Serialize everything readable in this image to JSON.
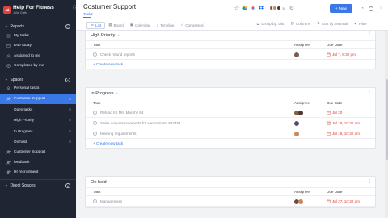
{
  "app": {
    "title": "Help For Fitness",
    "user": "Julia Gatto"
  },
  "sidebar": {
    "reports_label": "Reports",
    "reports_items": [
      {
        "label": "My tasks"
      },
      {
        "label": "Due today"
      },
      {
        "label": "Assigned to me"
      },
      {
        "label": "Completed by me"
      }
    ],
    "spaces_label": "Spaces",
    "spaces": [
      {
        "label": "Personal tasks",
        "active": false
      },
      {
        "label": "Customer Support",
        "active": true
      }
    ],
    "sub_items": [
      {
        "label": "Open tasks"
      },
      {
        "label": "High Priority"
      },
      {
        "label": "In Progress"
      },
      {
        "label": "On hold"
      }
    ],
    "more_spaces": [
      {
        "label": "Customer Support"
      },
      {
        "label": "feedback"
      },
      {
        "label": "Hr recruitment"
      }
    ],
    "direct_spaces_label": "Direct Spaces"
  },
  "header": {
    "project_title": "Costumer Support",
    "project_tab": "Tasks",
    "avatar_count": "5",
    "new_button": "New",
    "views": [
      {
        "label": "List",
        "icon": "list-icon",
        "active": true
      },
      {
        "label": "Board",
        "icon": "board-icon",
        "active": false
      },
      {
        "label": "Calendar",
        "icon": "calendar-icon",
        "active": false
      },
      {
        "label": "Timeline",
        "icon": "timeline-icon",
        "active": false
      },
      {
        "label": "Completed",
        "icon": "check-icon",
        "active": false
      }
    ],
    "tools": [
      {
        "label": "Group by: List",
        "icon": "group-icon"
      },
      {
        "label": "Columns",
        "icon": "columns-icon"
      },
      {
        "label": "Sort by: Manual",
        "icon": "sort-icon"
      },
      {
        "label": "Filter",
        "icon": "filter-icon"
      }
    ]
  },
  "columns": {
    "task": "Task",
    "assignee": "Assignee",
    "due": "Due Date"
  },
  "groups": [
    {
      "title": "High Priority",
      "add_label": "+ Create new task",
      "tasks": [
        {
          "name": "Check refund reports",
          "due": "Jul 7, 8:30 pm",
          "due_color": "#e0413a",
          "flag": true,
          "avatars": [
            "#7a5a4a"
          ]
        }
      ]
    },
    {
      "title": "In Progress",
      "add_label": "+ Create new task",
      "tasks": [
        {
          "name": "Refund for Mrs Murphy 64",
          "due": "Jul 20",
          "due_color": "#e0413a",
          "flag": false,
          "avatars": [
            "#8b5e3c",
            "#4a3a36"
          ]
        },
        {
          "name": "Sales conversion reports for Heron Farm #23454",
          "due": "Jul 18, 10:30 am",
          "due_color": "#e0413a",
          "flag": false,
          "avatars": [
            "#5b4a6a"
          ]
        },
        {
          "name": "Meeting requirements",
          "due": "Jul 18, 10:30 am",
          "due_color": "#e0413a",
          "flag": false,
          "avatars": [
            "#c98a5a"
          ]
        }
      ]
    },
    {
      "title": "On hold",
      "add_label": "",
      "tasks": [
        {
          "name": "Management",
          "due": "Jul 27, 10:30 am",
          "due_color": "#e0413a",
          "flag": false,
          "avatars": [
            "#6a4a3a",
            "#c98a5a"
          ]
        }
      ]
    }
  ],
  "colors": {
    "accent": "#3b78e7",
    "sidebar_bg": "#1f2533",
    "brand": "#e0413a",
    "overdue": "#e0413a"
  }
}
